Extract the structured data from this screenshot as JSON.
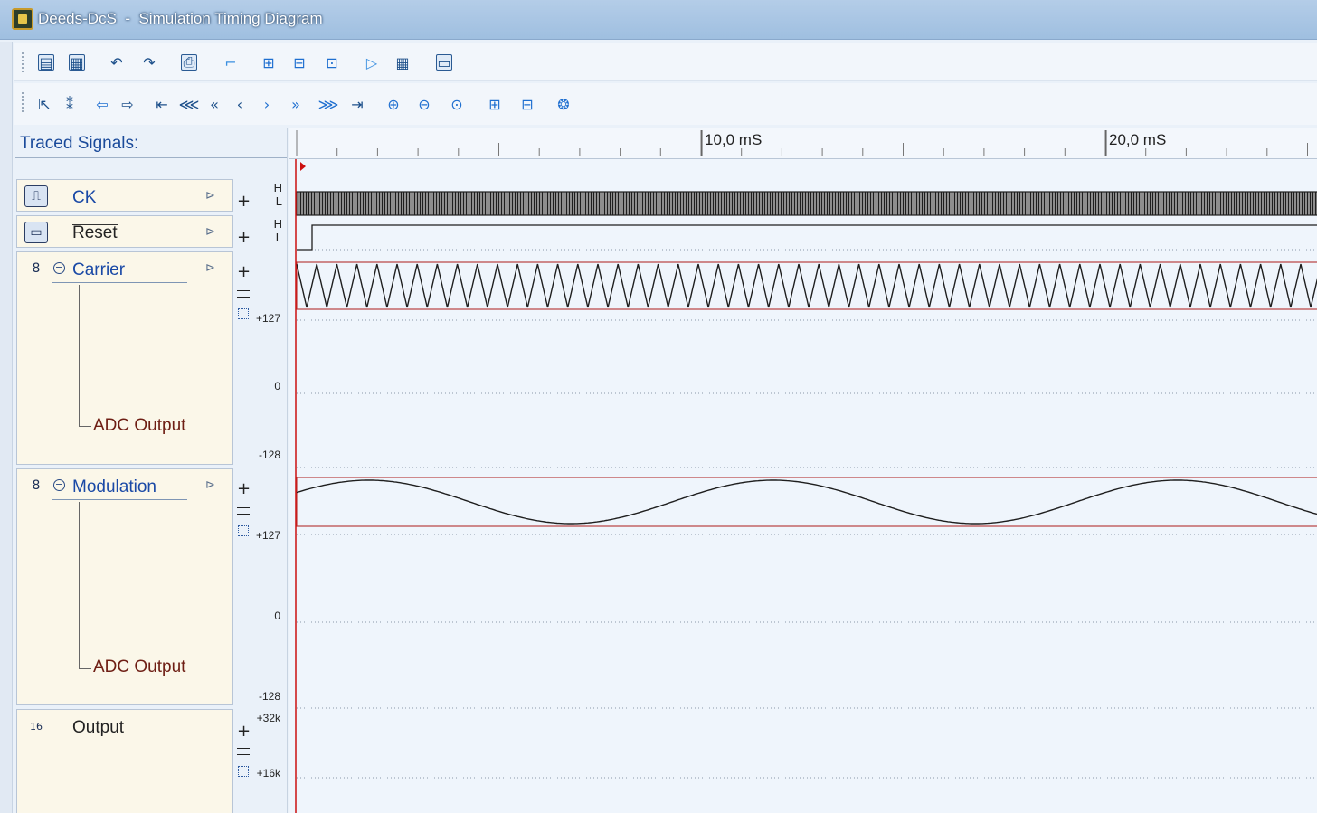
{
  "window": {
    "title": "Deeds-DcS  -  Simulation Timing Diagram"
  },
  "toolbar1": {
    "buttons": [
      "open-icon",
      "save-icon",
      "undo-icon",
      "redo-icon",
      "print-icon",
      "step-icon",
      "timing-icon",
      "split-icon",
      "select-icon",
      "play-icon",
      "grid-icon",
      "window-icon"
    ]
  },
  "toolbar2": {
    "buttons": [
      "pointer-add-icon",
      "pointer-multi-icon",
      "nav-left-icon",
      "nav-right-icon",
      "goto-start-icon",
      "fast-back-icon",
      "back-icon",
      "step-back-icon",
      "step-forward-icon",
      "forward-icon",
      "fast-forward-icon",
      "goto-end-icon",
      "zoom-in-icon",
      "zoom-out-icon",
      "zoom-fit-icon",
      "insert-icon",
      "remove-icon",
      "settings-icon"
    ]
  },
  "signals_panel": {
    "title": "Traced Signals:",
    "signals": [
      {
        "name": "CK",
        "high": "H",
        "low": "L"
      },
      {
        "name": "Reset",
        "high": "H",
        "low": "L"
      },
      {
        "name": "Carrier",
        "sub": "ADC Output",
        "max": "+127",
        "zero": "0",
        "min": "-128",
        "bus": "8"
      },
      {
        "name": "Modulation",
        "sub": "ADC Output",
        "max": "+127",
        "zero": "0",
        "min": "-128",
        "bus": "8"
      },
      {
        "name": "Output",
        "max": "+32k",
        "mid": "+16k",
        "bus": "16"
      }
    ]
  },
  "ruler": {
    "labels": [
      "10,0 mS",
      "20,0 mS"
    ]
  },
  "colors": {
    "cursor": "#cc1010",
    "waveform": "#1e1e1e",
    "bus_border": "#b84040"
  }
}
